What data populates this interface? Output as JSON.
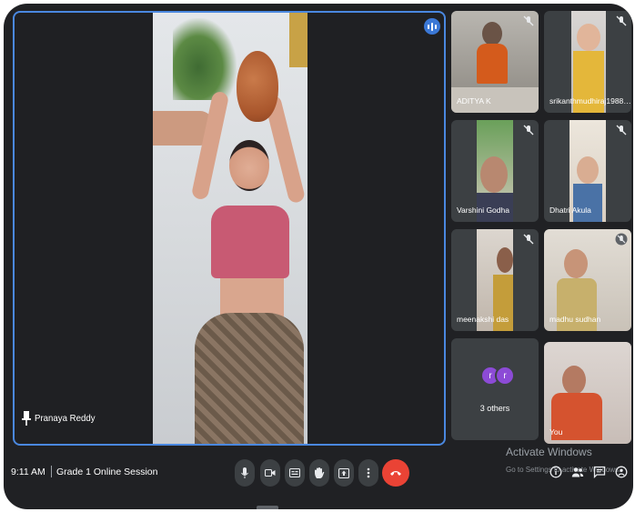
{
  "main": {
    "speaker_name": "Pranaya Reddy"
  },
  "participants": [
    {
      "name": "ADITYA K"
    },
    {
      "name": "srikanthmudhiraj1988 ..."
    },
    {
      "name": "Varshini Godha"
    },
    {
      "name": "Dhatri Akula"
    },
    {
      "name": "meenakshi das"
    },
    {
      "name": "madhu sudhan"
    },
    {
      "name": "3 others",
      "initials": [
        "r",
        "r"
      ]
    },
    {
      "name": "You"
    }
  ],
  "bottom_bar": {
    "time": "9:11 AM",
    "meeting_title": "Grade 1 Online Session"
  },
  "watermark": {
    "title": "Activate Windows",
    "subtitle": "Go to Settings to activate Windows."
  },
  "colors": {
    "background": "#202124",
    "tile": "#3c4043",
    "active_border": "#4a88e0",
    "end_call": "#ea4335",
    "others_avatar": "#8c4bd6"
  },
  "icons": {
    "controls": [
      "microphone-icon",
      "camera-icon",
      "captions-icon",
      "raise-hand-icon",
      "present-icon",
      "more-options-icon",
      "end-call-icon"
    ],
    "side": [
      "info-icon",
      "people-icon",
      "chat-icon",
      "activities-icon"
    ]
  }
}
